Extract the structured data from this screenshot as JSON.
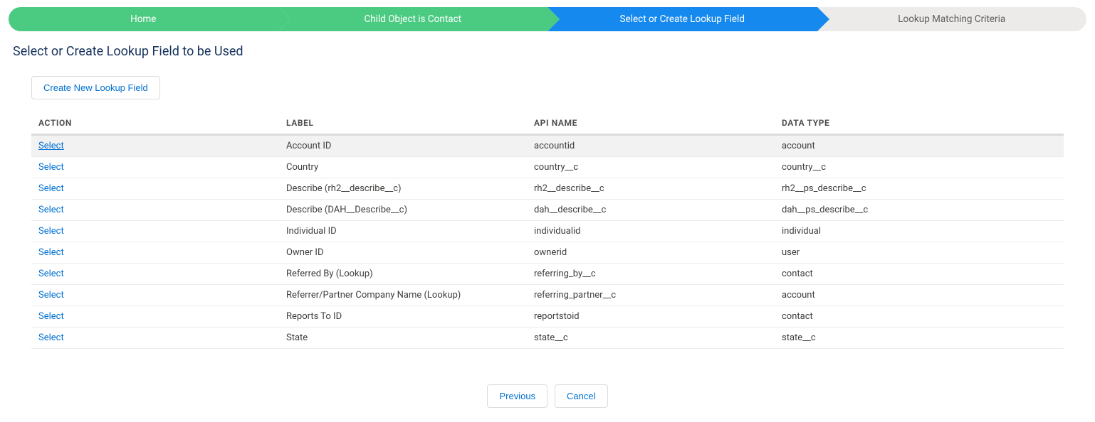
{
  "wizard": {
    "steps": [
      {
        "label": "Home",
        "state": "green"
      },
      {
        "label": "Child Object is Contact",
        "state": "green"
      },
      {
        "label": "Select or Create Lookup Field",
        "state": "blue"
      },
      {
        "label": "Lookup Matching Criteria",
        "state": "gray"
      }
    ]
  },
  "page_title": "Select or Create Lookup Field to be Used",
  "buttons": {
    "create_new": "Create New Lookup Field",
    "previous": "Previous",
    "cancel": "Cancel"
  },
  "table": {
    "headers": {
      "action": "ACTION",
      "label": "LABEL",
      "api_name": "API NAME",
      "data_type": "DATA TYPE"
    },
    "action_label": "Select",
    "rows": [
      {
        "label": "Account ID",
        "api": "accountid",
        "type": "account",
        "hovered": true
      },
      {
        "label": "Country",
        "api": "country__c",
        "type": "country__c"
      },
      {
        "label": "Describe (rh2__describe__c)",
        "api": "rh2__describe__c",
        "type": "rh2__ps_describe__c"
      },
      {
        "label": "Describe (DAH__Describe__c)",
        "api": "dah__describe__c",
        "type": "dah__ps_describe__c"
      },
      {
        "label": "Individual ID",
        "api": "individualid",
        "type": "individual"
      },
      {
        "label": "Owner ID",
        "api": "ownerid",
        "type": "user"
      },
      {
        "label": "Referred By (Lookup)",
        "api": "referring_by__c",
        "type": "contact"
      },
      {
        "label": "Referrer/Partner Company Name (Lookup)",
        "api": "referring_partner__c",
        "type": "account"
      },
      {
        "label": "Reports To ID",
        "api": "reportstoid",
        "type": "contact"
      },
      {
        "label": "State",
        "api": "state__c",
        "type": "state__c"
      }
    ]
  }
}
